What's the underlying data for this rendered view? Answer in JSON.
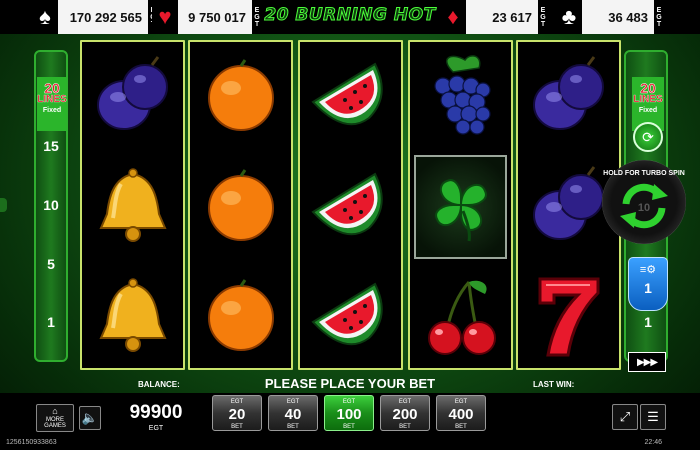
{
  "jackpots": [
    {
      "suit": "spades",
      "symbol": "♠",
      "value": "170 292 565",
      "color": "#ffffff"
    },
    {
      "suit": "hearts",
      "symbol": "♥",
      "value": "9 750 017",
      "color": "#e8192c"
    },
    {
      "suit": "diamonds",
      "symbol": "♦",
      "value": "23 617",
      "color": "#e8192c"
    },
    {
      "suit": "clubs",
      "symbol": "♣",
      "value": "36 483",
      "color": "#ffffff"
    }
  ],
  "jackpot_brand": "EGT",
  "game_title": "20 BURNING HOT",
  "reels": [
    [
      "plum",
      "bell",
      "bell"
    ],
    [
      "orange",
      "orange",
      "orange"
    ],
    [
      "watermelon",
      "watermelon",
      "watermelon"
    ],
    [
      "grapes",
      "clover",
      "cherries"
    ],
    [
      "plum",
      "plum",
      "seven"
    ]
  ],
  "left_panel": {
    "lines_count": "20",
    "lines_word": "LINES",
    "fixed_word": "Fixed",
    "numbers": [
      "15",
      "10",
      "5",
      "1"
    ]
  },
  "right_panel": {
    "lines_count": "20",
    "lines_word": "LINES",
    "fixed_word": "Fixed",
    "spin_hint": "HOLD FOR TURBO SPIN",
    "ghost_number": "10",
    "denomination": "1",
    "bottom_number": "1",
    "speed_label": "▶▶▶"
  },
  "message": "PLEASE PLACE YOUR BET",
  "balance": {
    "label": "BALANCE:",
    "value": "99900",
    "currency": "EGT"
  },
  "last_win_label": "LAST WIN:",
  "more_games": {
    "line1": "MORE",
    "line2": "GAMES"
  },
  "bets": [
    {
      "brand": "EGT",
      "value": "20",
      "label": "BET",
      "active": false
    },
    {
      "brand": "EGT",
      "value": "40",
      "label": "BET",
      "active": false
    },
    {
      "brand": "EGT",
      "value": "100",
      "label": "BET",
      "active": true
    },
    {
      "brand": "EGT",
      "value": "200",
      "label": "BET",
      "active": false
    },
    {
      "brand": "EGT",
      "value": "400",
      "label": "BET",
      "active": false
    }
  ],
  "status": {
    "session_id": "1256150933863",
    "time": "22:46"
  },
  "icons": {
    "sound": "speaker-icon",
    "fullscreen": "fullscreen-icon",
    "menu": "hamburger-menu-icon",
    "autoplay": "autoplay-icon",
    "coin": "coin-stack-icon"
  }
}
